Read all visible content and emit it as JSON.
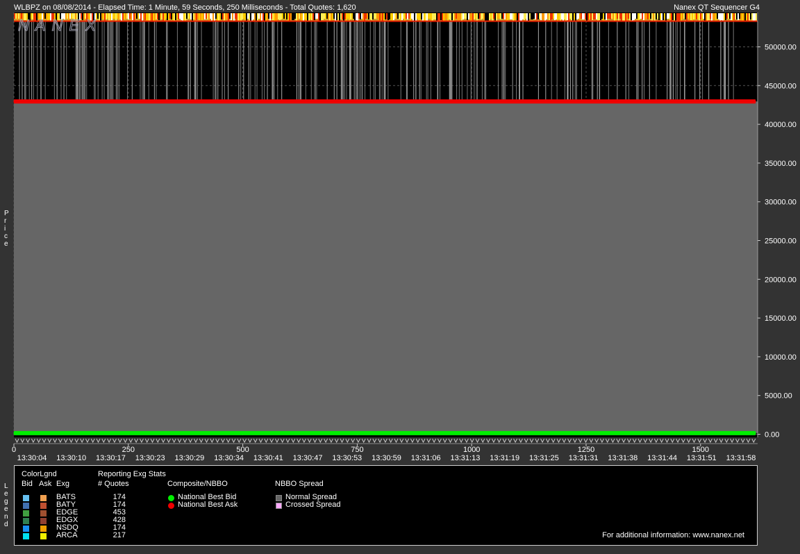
{
  "header": {
    "title_left": "WLBPZ on 08/08/2014  -  Elapsed Time: 1 Minute, 59 Seconds, 250 Milliseconds  -  Total Quotes: 1,620",
    "title_right": "Nanex QT Sequencer G4",
    "watermark": "NANEX"
  },
  "axis_labels": {
    "y_vertical": "Price",
    "legend_vertical": "Legend"
  },
  "chart_data": {
    "type": "line",
    "ylabel": "Price",
    "ylim": [
      0,
      54000
    ],
    "yticks": [
      0,
      5000,
      10000,
      15000,
      20000,
      25000,
      30000,
      35000,
      40000,
      45000,
      50000
    ],
    "ytick_labels": [
      "0.00",
      "5000.00",
      "10000.00",
      "15000.00",
      "20000.00",
      "25000.00",
      "30000.00",
      "35000.00",
      "40000.00",
      "45000.00",
      "50000.00"
    ],
    "xlim": [
      0,
      1620
    ],
    "xticks": [
      0,
      250,
      500,
      750,
      1000,
      1250,
      1500
    ],
    "xtick_labels": [
      "0",
      "250",
      "500",
      "750",
      "1000",
      "1250",
      "1500"
    ],
    "time_labels": [
      "13:30:04",
      "13:30:10",
      "13:30:17",
      "13:30:23",
      "13:30:29",
      "13:30:34",
      "13:30:41",
      "13:30:47",
      "13:30:53",
      "13:30:59",
      "13:31:06",
      "13:31:13",
      "13:31:19",
      "13:31:25",
      "13:31:31",
      "13:31:38",
      "13:31:44",
      "13:31:51",
      "13:31:58"
    ],
    "grid": true,
    "series": [
      {
        "name": "National Best Bid",
        "color": "#00ee00",
        "values": [
          [
            0,
            150
          ],
          [
            1620,
            150
          ]
        ]
      },
      {
        "name": "National Best Ask",
        "color": "#ee0000",
        "values": [
          [
            0,
            42950
          ],
          [
            1620,
            42950
          ]
        ]
      }
    ],
    "spread_fill": {
      "name": "Normal Spread",
      "color": "#666666"
    }
  },
  "legend": {
    "col_colorlgnd": "ColorLgnd",
    "hdr_bid": "Bid",
    "hdr_ask": "Ask",
    "hdr_exg": "Exg",
    "col_stats": "Reporting Exg Stats",
    "hdr_quotes": "# Quotes",
    "col_composite": "Composite/NBBO",
    "col_spread": "NBBO Spread",
    "exchanges": [
      {
        "name": "BATS",
        "quotes": "174",
        "bid_color": "#66c0f0",
        "ask_color": "#f0a050"
      },
      {
        "name": "BATY",
        "quotes": "174",
        "bid_color": "#4070b0",
        "ask_color": "#c05030"
      },
      {
        "name": "EDGE",
        "quotes": "453",
        "bid_color": "#40a040",
        "ask_color": "#a05030"
      },
      {
        "name": "EDGX",
        "quotes": "428",
        "bid_color": "#308050",
        "ask_color": "#904030"
      },
      {
        "name": "NSDQ",
        "quotes": "174",
        "bid_color": "#1890f0",
        "ask_color": "#f0a000"
      },
      {
        "name": "ARCA",
        "quotes": "217",
        "bid_color": "#00e0f0",
        "ask_color": "#f0f000"
      }
    ],
    "nbbo_bid": "National Best Bid",
    "nbbo_ask": "National Best Ask",
    "normal_spread": "Normal Spread",
    "crossed_spread": "Crossed Spread",
    "normal_color": "#666666",
    "crossed_color": "#ffaaff",
    "footer": "For additional information: www.nanex.net"
  }
}
